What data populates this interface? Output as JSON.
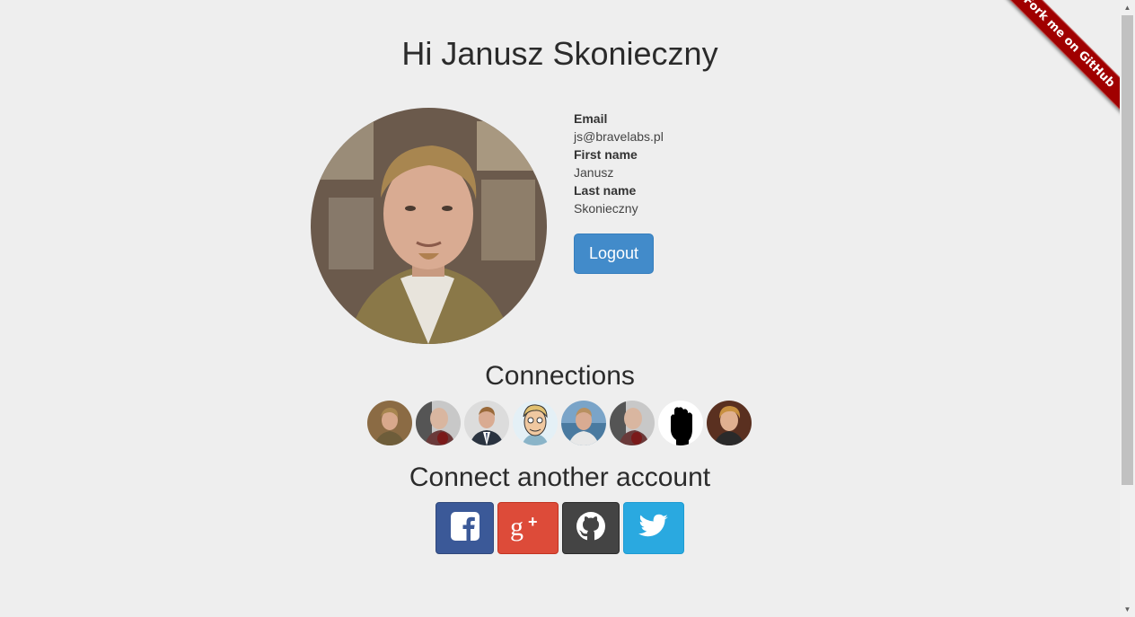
{
  "header": {
    "title": "Hi Janusz Skonieczny"
  },
  "profile": {
    "email_label": "Email",
    "email": "js@bravelabs.pl",
    "first_name_label": "First name",
    "first_name": "Janusz",
    "last_name_label": "Last name",
    "last_name": "Skonieczny",
    "logout_label": "Logout"
  },
  "connections": {
    "title": "Connections",
    "avatars": [
      "person-photo",
      "person-photo",
      "person-photo",
      "cartoon-avatar",
      "person-photo",
      "person-photo",
      "raised-fist-icon",
      "person-photo"
    ]
  },
  "providers": {
    "title": "Connect another account",
    "items": [
      {
        "icon": "facebook-icon",
        "color": "#3b5998"
      },
      {
        "icon": "google-plus-icon",
        "color": "#dd4b39"
      },
      {
        "icon": "github-icon",
        "color": "#444444"
      },
      {
        "icon": "twitter-icon",
        "color": "#2aa9e0"
      }
    ]
  },
  "ribbon": {
    "label": "Fork me on GitHub",
    "color": "#a00000"
  },
  "colors": {
    "background": "#eeeeee",
    "primary": "#428bca"
  }
}
